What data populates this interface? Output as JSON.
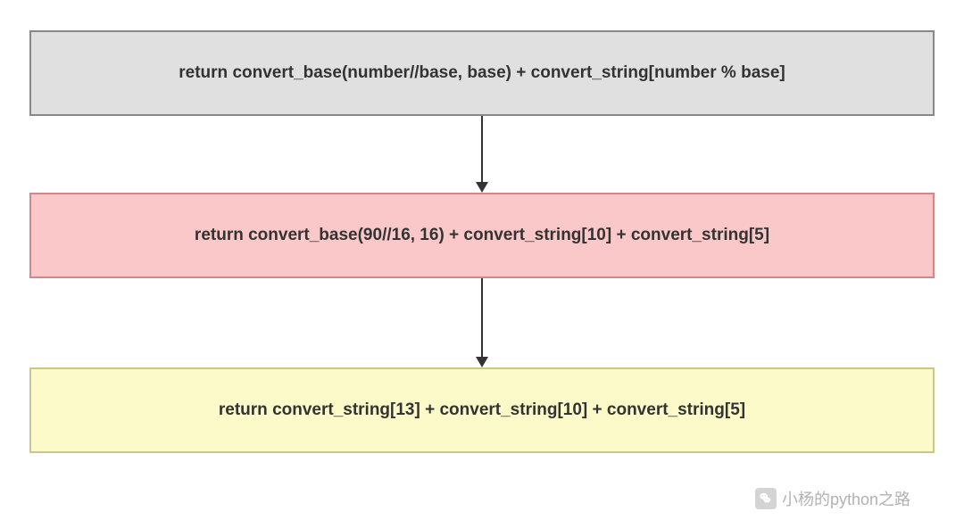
{
  "boxes": [
    {
      "text": "return convert_base(number//base, base) + convert_string[number % base]",
      "bg": "#e0e0e0",
      "border": "#888888"
    },
    {
      "text": "return convert_base(90//16, 16) + convert_string[10] + convert_string[5]",
      "bg": "#fac8c8",
      "border": "#d08888"
    },
    {
      "text": "return convert_string[13] + convert_string[10] + convert_string[5]",
      "bg": "#fcfac8",
      "border": "#c8c888"
    }
  ],
  "watermark": {
    "text": "小杨的python之路"
  }
}
